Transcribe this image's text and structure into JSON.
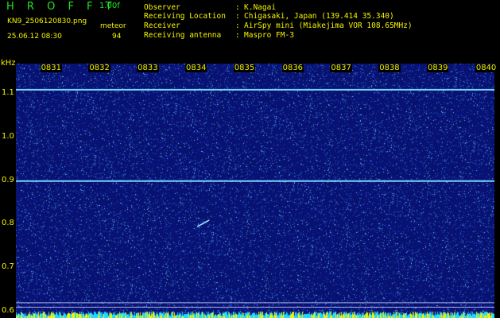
{
  "header": {
    "app_title": "H R O F F T",
    "version": "1.00f",
    "filename": "KN9_2506120830.png",
    "datetime": "25.06.12 08:30",
    "meteor_label": "meteor",
    "meteor_count": "94",
    "info": [
      {
        "label": "Observer",
        "value": "K.Nagai"
      },
      {
        "label": "Receiving Location",
        "value": "Chigasaki, Japan (139.414 35.340)"
      },
      {
        "label": "Receiver",
        "value": "AirSpy mini (Miakejima VOR 108.65MHz)"
      },
      {
        "label": "Receiving antenna",
        "value": "Maspro FM-3"
      }
    ],
    "colon": ":"
  },
  "chart_data": {
    "type": "heatmap",
    "ylabel": "kHz",
    "yticks": [
      "1.1",
      "1.0",
      "0.9",
      "0.8",
      "0.7",
      "0.6"
    ],
    "ytick_values": [
      1.1,
      1.0,
      0.9,
      0.8,
      0.7,
      0.6
    ],
    "ylim": [
      0.585,
      1.17
    ],
    "x_tick_labels": [
      "0831",
      "0832",
      "0833",
      "0834",
      "0835",
      "0836",
      "0837",
      "0838",
      "0839",
      "0840"
    ],
    "x_tick_minutes": [
      1,
      2,
      3,
      4,
      5,
      6,
      7,
      8,
      9,
      10
    ],
    "xlim_minutes": [
      0.3,
      10.2
    ],
    "signal_lines_khz": [
      1.11,
      0.9
    ],
    "reference_lines_khz": [
      0.62,
      0.61
    ],
    "meteor_trail": {
      "start_minute": 4.05,
      "start_khz": 0.795,
      "end_minute": 4.3,
      "end_khz": 0.81
    },
    "colors": {
      "background_noise": "#0a1a73",
      "signal": "#7fdcff",
      "axis_text": "#f0f000",
      "bottom_band_cyan": "#20d8ff",
      "bottom_band_yellow": "#f4f400"
    }
  }
}
